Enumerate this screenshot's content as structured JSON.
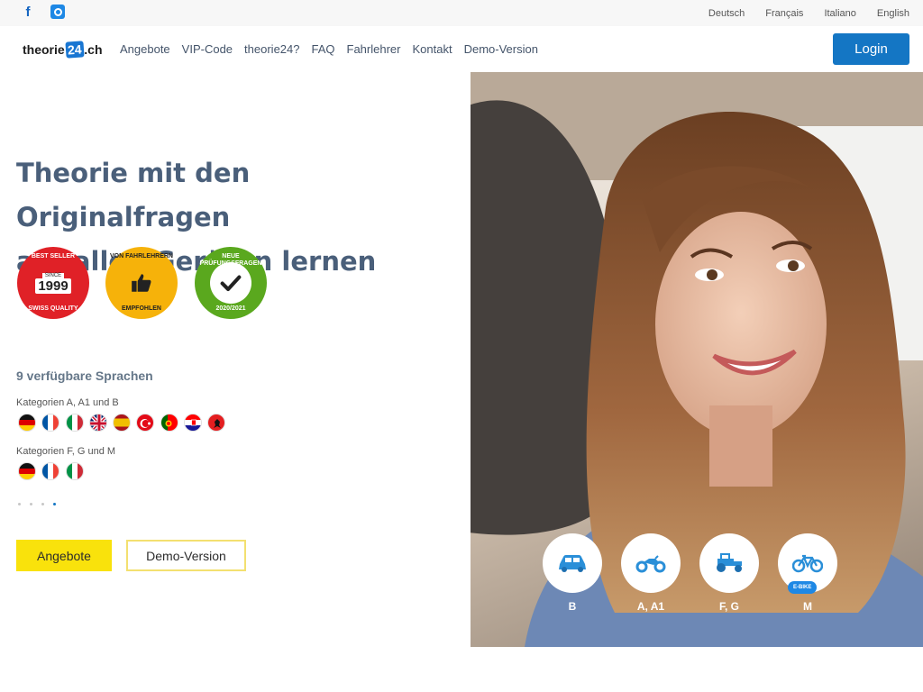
{
  "topbar": {
    "social": [
      {
        "icon": "facebook-icon"
      },
      {
        "icon": "instagram-icon"
      }
    ],
    "languages": [
      "Deutsch",
      "Français",
      "Italiano",
      "English"
    ]
  },
  "header": {
    "logo": {
      "prefix": "theorie",
      "badge": "24",
      "suffix": ".ch"
    },
    "nav": [
      "Angebote",
      "VIP-Code",
      "theorie24?",
      "FAQ",
      "Fahrlehrer",
      "Kontakt",
      "Demo-Version"
    ],
    "login": "Login"
  },
  "hero": {
    "headline_line1": "Theorie mit den Originalfragen",
    "headline_line2": "auf allen Geräten lernen",
    "seals": [
      {
        "top": "BEST SELLER",
        "since": "SINCE",
        "year": "1999",
        "bottom": "SWISS QUALITY"
      },
      {
        "top": "VON FAHRLEHRERN",
        "bottom": "EMPFOHLEN",
        "icon": "thumbs-up-icon"
      },
      {
        "top": "NEUE PRÜFUNGSFRAGEN",
        "bottom": "2020/2021",
        "icon": "checkmark-icon"
      }
    ],
    "languages_title": "9 verfügbare Sprachen",
    "category_groups": [
      {
        "label": "Kategorien A, A1 und B",
        "flags": [
          "de",
          "fr",
          "it",
          "en",
          "es",
          "tr",
          "pt",
          "hr",
          "sq"
        ]
      },
      {
        "label": "Kategorien F, G und M",
        "flags": [
          "de",
          "fr",
          "it"
        ]
      }
    ],
    "slider_dots": 4,
    "active_dot": 4,
    "buttons": {
      "offers": "Angebote",
      "demo": "Demo-Version"
    }
  },
  "photo": {
    "categories": [
      {
        "label": "B",
        "icon": "car-icon"
      },
      {
        "label": "A, A1",
        "icon": "motorcycle-icon"
      },
      {
        "label": "F, G",
        "icon": "tractor-icon"
      },
      {
        "label": "M",
        "icon": "bicycle-icon",
        "badge": "E-BIKE"
      }
    ]
  },
  "colors": {
    "accent_blue": "#1476c4",
    "headline": "#4a5f7a",
    "yellow": "#f9e20c"
  }
}
